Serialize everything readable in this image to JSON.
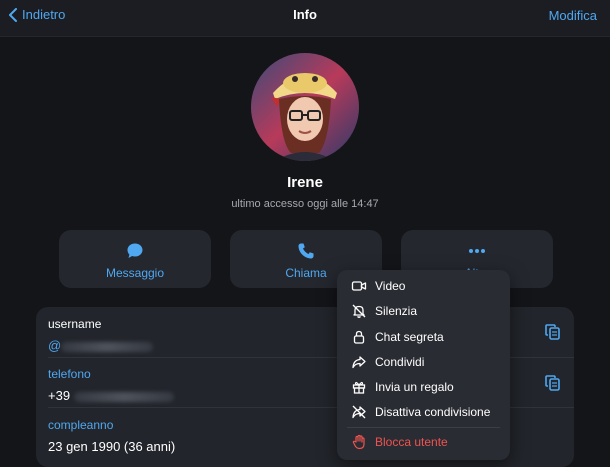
{
  "nav": {
    "back_label": "Indietro",
    "title": "Info",
    "edit_label": "Modifica"
  },
  "profile": {
    "name": "Irene",
    "status": "ultimo accesso oggi alle 14:47"
  },
  "actions": {
    "message_label": "Messaggio",
    "call_label": "Chiama",
    "more_label": "Altro"
  },
  "info": {
    "username_key": "username",
    "username_prefix": "@",
    "phone_key": "telefono",
    "phone_prefix": "+39",
    "birthday_key": "compleanno",
    "birthday_value": "23 gen 1990 (36 anni)"
  },
  "menu": {
    "items": [
      {
        "label": "Video",
        "icon": "video-camera-icon"
      },
      {
        "label": "Silenzia",
        "icon": "bell-muted-icon"
      },
      {
        "label": "Chat segreta",
        "icon": "lock-icon"
      },
      {
        "label": "Condividi",
        "icon": "share-arrow-icon"
      },
      {
        "label": "Invia un regalo",
        "icon": "gift-icon"
      },
      {
        "label": "Disattiva condivisione",
        "icon": "share-off-icon"
      }
    ],
    "danger_item": {
      "label": "Blocca utente",
      "icon": "hand-stop-icon"
    }
  },
  "colors": {
    "accent": "#4fa8f0",
    "danger": "#ef5350",
    "background": "#141519",
    "card": "#22252b"
  }
}
